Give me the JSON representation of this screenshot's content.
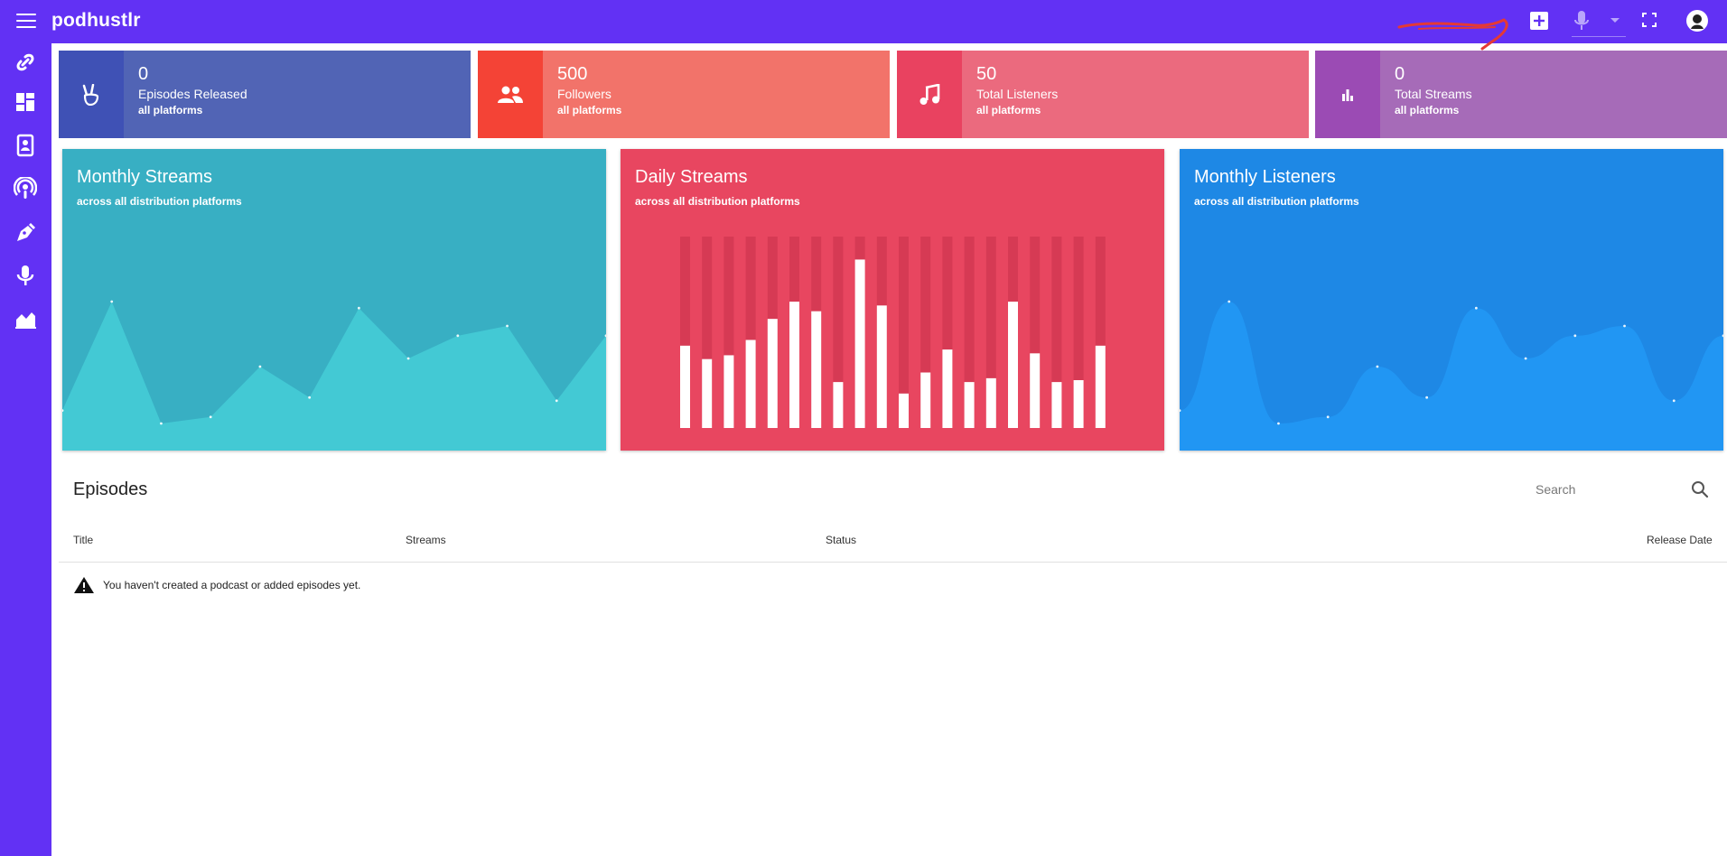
{
  "app": {
    "name": "podhustlr"
  },
  "stats": [
    {
      "value": "0",
      "label": "Episodes Released",
      "sub": "all platforms",
      "color": "#5164b5",
      "icon_bg": "#3f51b5",
      "icon": "peace-hand-icon"
    },
    {
      "value": "500",
      "label": "Followers",
      "sub": "all platforms",
      "color": "#f2736a",
      "icon_bg": "#f44336",
      "icon": "users-icon"
    },
    {
      "value": "50",
      "label": "Total Listeners",
      "sub": "all platforms",
      "color": "#eb6a7e",
      "icon_bg": "#e94260",
      "icon": "music-note-icon"
    },
    {
      "value": "0",
      "label": "Total Streams",
      "sub": "all platforms",
      "color": "#a66bb8",
      "icon_bg": "#9b4bb4",
      "icon": "bar-chart-icon"
    }
  ],
  "charts": {
    "monthly_streams": {
      "title": "Monthly Streams",
      "subtitle": "across all distribution platforms",
      "bg": "#38afc3",
      "fill": "#43c9d4"
    },
    "daily_streams": {
      "title": "Daily Streams",
      "subtitle": "across all distribution platforms",
      "bg": "#e84660",
      "bar": "#ffffff",
      "track": "#d63a54"
    },
    "monthly_listeners": {
      "title": "Monthly Listeners",
      "subtitle": "across all distribution platforms",
      "bg": "#1e88e5",
      "fill": "#2196f3"
    }
  },
  "chart_data": [
    {
      "type": "area",
      "title": "Monthly Streams",
      "values": [
        0.18,
        0.85,
        0.1,
        0.14,
        0.45,
        0.26,
        0.81,
        0.5,
        0.64,
        0.7,
        0.24,
        0.64
      ]
    },
    {
      "type": "bar",
      "title": "Daily Streams",
      "values": [
        0.43,
        0.36,
        0.38,
        0.46,
        0.57,
        0.66,
        0.61,
        0.24,
        0.88,
        0.64,
        0.18,
        0.29,
        0.41,
        0.24,
        0.26,
        0.66,
        0.39,
        0.24,
        0.25,
        0.43
      ]
    },
    {
      "type": "area",
      "title": "Monthly Listeners",
      "values": [
        0.18,
        0.85,
        0.1,
        0.14,
        0.45,
        0.26,
        0.81,
        0.5,
        0.64,
        0.7,
        0.24,
        0.64
      ]
    }
  ],
  "episodes": {
    "title": "Episodes",
    "search_placeholder": "Search",
    "columns": [
      "Title",
      "Streams",
      "Status",
      "Release Date"
    ],
    "empty_message": "You haven't created a podcast or added episodes yet."
  },
  "sidebar": {
    "items": [
      "link-icon",
      "dashboard-icon",
      "contacts-icon",
      "podcast-icon",
      "pen-icon",
      "microphone-icon",
      "area-chart-icon"
    ]
  }
}
